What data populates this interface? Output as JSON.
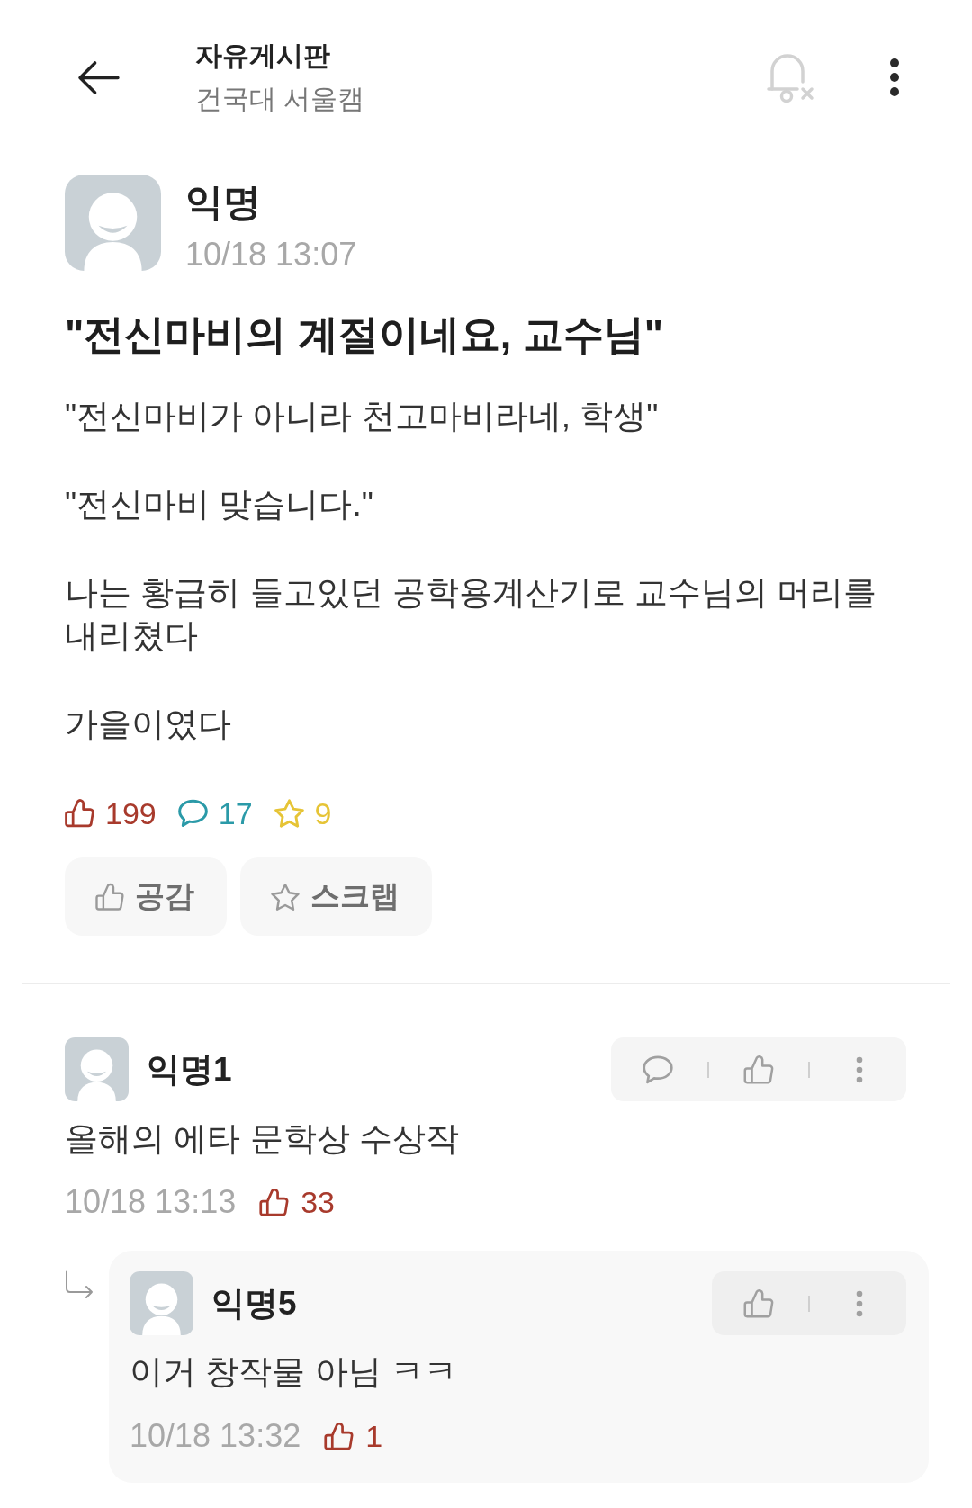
{
  "header": {
    "title": "자유게시판",
    "subtitle": "건국대 서울캠"
  },
  "post": {
    "author": "익명",
    "time": "10/18 13:07",
    "title": "\"전신마비의 계절이네요, 교수님\"",
    "paragraphs": [
      "\"전신마비가 아니라 천고마비라네, 학생\"",
      "\"전신마비 맞습니다.\"",
      "나는 황급히 들고있던 공학용계산기로 교수님의 머리를 내리쳤다",
      "가을이였다"
    ],
    "counts": [
      {
        "kind": "like",
        "value": "199",
        "color": "#a83a2c"
      },
      {
        "kind": "comment",
        "value": "17",
        "color": "#2b9aa8"
      },
      {
        "kind": "scrap",
        "value": "9",
        "color": "#e6c436"
      }
    ],
    "buttons": [
      {
        "kind": "like",
        "label": "공감"
      },
      {
        "kind": "scrap",
        "label": "스크랩"
      }
    ]
  },
  "comments": [
    {
      "author": "익명1",
      "text": "올해의 에타 문학상 수상작",
      "time": "10/18 13:13",
      "likes": "33",
      "actions": [
        {
          "kind": "reply"
        },
        {
          "kind": "like"
        },
        {
          "kind": "more"
        }
      ],
      "replies": [
        {
          "author": "익명5",
          "text": "이거 창작물 아님 ㅋㅋ",
          "time": "10/18 13:32",
          "likes": "1",
          "actions": [
            {
              "kind": "like"
            },
            {
              "kind": "more"
            }
          ]
        }
      ]
    }
  ]
}
